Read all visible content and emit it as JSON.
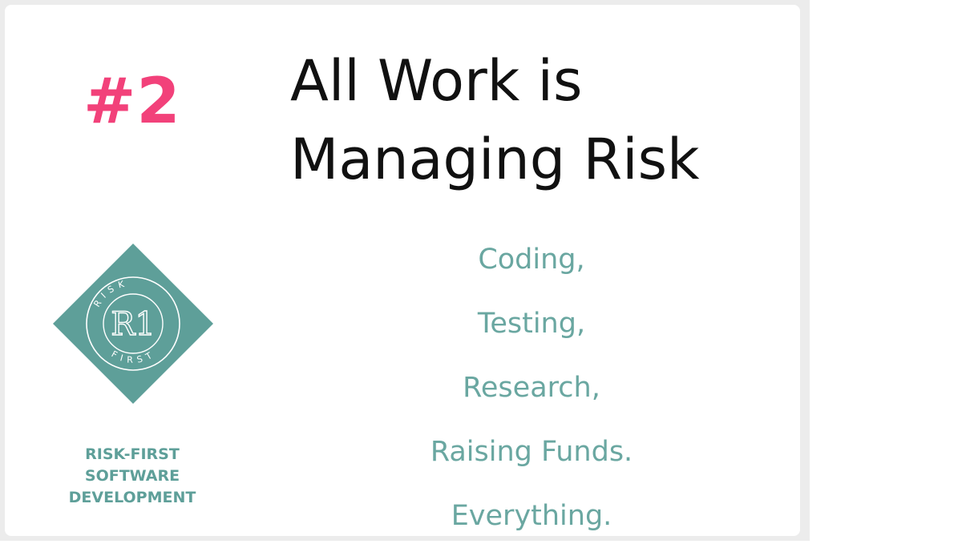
{
  "slide": {
    "number": "#2",
    "title_line1": "All Work is",
    "title_line2": "Managing Risk",
    "activities": [
      "Coding,",
      "Testing,",
      "Research,",
      "Raising Funds.",
      "Everything."
    ]
  },
  "brand": {
    "logo_monogram": "R1",
    "logo_top_text": "RISK",
    "logo_bottom_text": "FIRST",
    "line1": "RISK-FIRST",
    "line2": "SOFTWARE",
    "line3": "DEVELOPMENT"
  },
  "colors": {
    "accent_pink": "#f2417a",
    "teal": "#5e9f99",
    "teal_light": "#6aa7a1",
    "title_text": "#111111",
    "frame": "#ececec"
  }
}
